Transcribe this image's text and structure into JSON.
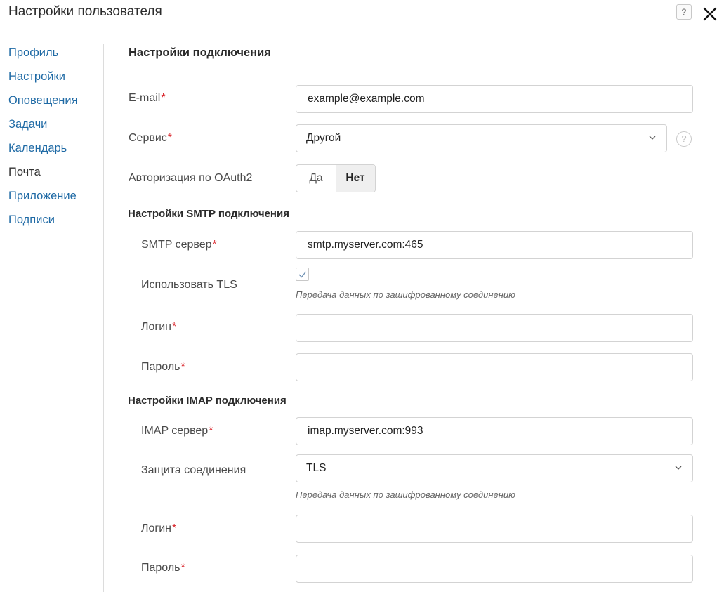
{
  "header": {
    "title": "Настройки пользователя",
    "help_glyph": "?",
    "close_icon": "close-icon"
  },
  "sidebar": {
    "items": [
      {
        "label": "Профиль",
        "active": false
      },
      {
        "label": "Настройки",
        "active": false
      },
      {
        "label": "Оповещения",
        "active": false
      },
      {
        "label": "Задачи",
        "active": false
      },
      {
        "label": "Календарь",
        "active": false
      },
      {
        "label": "Почта",
        "active": true
      },
      {
        "label": "Приложение",
        "active": false
      },
      {
        "label": "Подписи",
        "active": false
      }
    ]
  },
  "connection": {
    "title": "Настройки подключения",
    "email": {
      "label": "E-mail",
      "required": "*",
      "value": "example@example.com"
    },
    "service": {
      "label": "Сервис",
      "required": "*",
      "value": "Другой",
      "help": "?"
    },
    "oauth": {
      "label": "Авторизация по OAuth2",
      "yes": "Да",
      "no": "Нет",
      "selected": "Нет"
    }
  },
  "smtp": {
    "title": "Настройки SMTP подключения",
    "server": {
      "label": "SMTP сервер",
      "required": "*",
      "value": "smtp.myserver.com:465"
    },
    "tls": {
      "label": "Использовать TLS",
      "checked": true,
      "hint": "Передача данных по зашифрованному соединению"
    },
    "login": {
      "label": "Логин",
      "required": "*",
      "value": ""
    },
    "password": {
      "label": "Пароль",
      "required": "*",
      "value": ""
    }
  },
  "imap": {
    "title": "Настройки IMAP подключения",
    "server": {
      "label": "IMAP сервер",
      "required": "*",
      "value": "imap.myserver.com:993"
    },
    "security": {
      "label": "Защита соединения",
      "value": "TLS",
      "hint": "Передача данных по зашифрованному соединению"
    },
    "login": {
      "label": "Логин",
      "required": "*",
      "value": ""
    },
    "password": {
      "label": "Пароль",
      "required": "*",
      "value": ""
    }
  },
  "colors": {
    "link": "#1f6aa5",
    "required": "#d9262c",
    "border": "#d3d3d3"
  }
}
